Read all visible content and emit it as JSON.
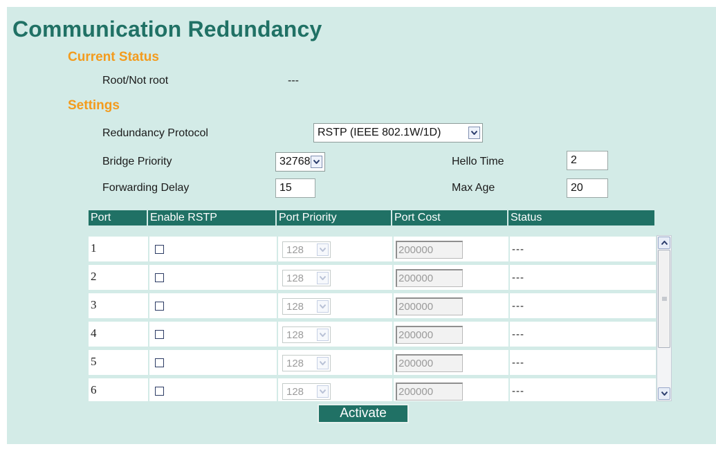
{
  "page_title": "Communication Redundancy",
  "current_status": {
    "heading": "Current Status",
    "root_label": "Root/Not root",
    "root_value": "---"
  },
  "settings": {
    "heading": "Settings",
    "redundancy_protocol_label": "Redundancy Protocol",
    "redundancy_protocol_value": "RSTP (IEEE 802.1W/1D)",
    "bridge_priority_label": "Bridge Priority",
    "bridge_priority_value": "32768",
    "hello_time_label": "Hello Time",
    "hello_time_value": "2",
    "forwarding_delay_label": "Forwarding Delay",
    "forwarding_delay_value": "15",
    "max_age_label": "Max Age",
    "max_age_value": "20"
  },
  "ports_table": {
    "columns": [
      "Port",
      "Enable RSTP",
      "Port Priority",
      "Port Cost",
      "Status"
    ],
    "rows": [
      {
        "port": "1",
        "enabled": false,
        "priority": "128",
        "cost": "200000",
        "status": "---"
      },
      {
        "port": "2",
        "enabled": false,
        "priority": "128",
        "cost": "200000",
        "status": "---"
      },
      {
        "port": "3",
        "enabled": false,
        "priority": "128",
        "cost": "200000",
        "status": "---"
      },
      {
        "port": "4",
        "enabled": false,
        "priority": "128",
        "cost": "200000",
        "status": "---"
      },
      {
        "port": "5",
        "enabled": false,
        "priority": "128",
        "cost": "200000",
        "status": "---"
      },
      {
        "port": "6",
        "enabled": false,
        "priority": "128",
        "cost": "200000",
        "status": "---"
      }
    ]
  },
  "activate_label": "Activate",
  "colors": {
    "background": "#d3ebe7",
    "title": "#207165",
    "section_heading": "#f39b1d",
    "table_header": "#207165"
  }
}
